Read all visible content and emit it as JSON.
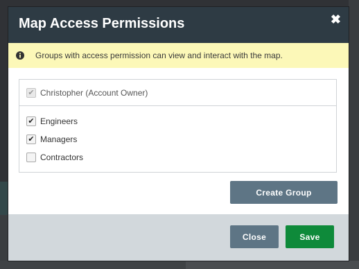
{
  "modal": {
    "title": "Map Access Permissions",
    "close_glyph": "✖",
    "notice": {
      "icon": "info-circle-icon",
      "text": "Groups with access permission can view and interact with the map."
    },
    "owner": {
      "label": "Christopher (Account Owner)",
      "checked": true,
      "disabled": true
    },
    "groups": [
      {
        "label": "Engineers",
        "checked": true
      },
      {
        "label": "Managers",
        "checked": true
      },
      {
        "label": "Contractors",
        "checked": false
      }
    ],
    "create_group_label": "Create Group",
    "footer": {
      "close_label": "Close",
      "save_label": "Save"
    },
    "colors": {
      "header": "#2e3b44",
      "notice_bg": "#fcf8b8",
      "secondary_button": "#5e7585",
      "save_button": "#0e8a3a",
      "footer_bg": "#d2d8dc"
    }
  }
}
